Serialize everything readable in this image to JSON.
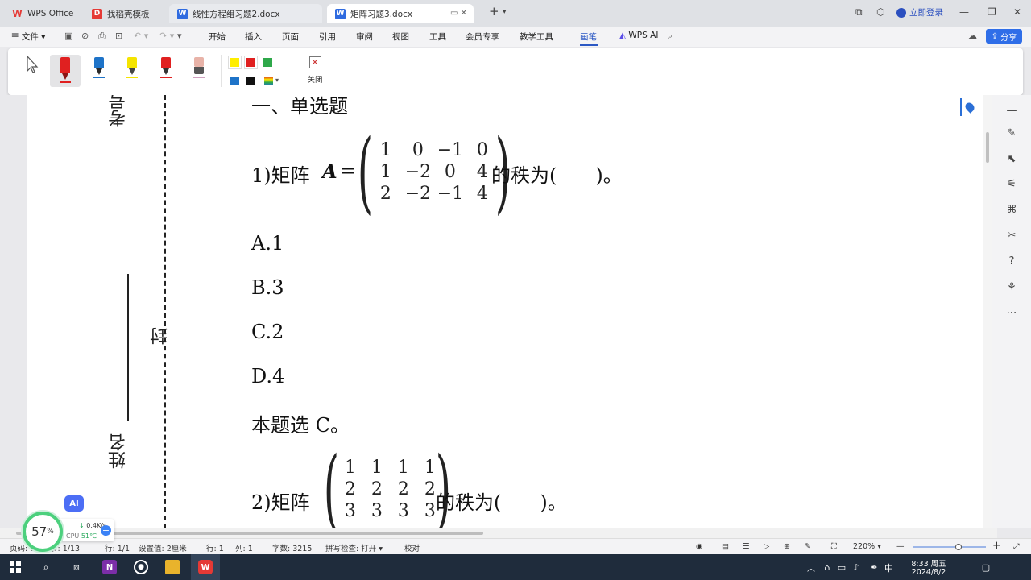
{
  "tabs": [
    {
      "label": "WPS Office",
      "icon": "wps-logo-icon",
      "color": "#e53935"
    },
    {
      "label": "找稻壳模板",
      "icon": "docer-icon",
      "color": "#e53935"
    },
    {
      "label": "线性方程组习题2.docx",
      "icon": "word-doc-icon",
      "color": "#2f6be0"
    },
    {
      "label": "矩阵习题3.docx",
      "icon": "word-doc-icon",
      "color": "#2f6be0",
      "active": true
    }
  ],
  "titlebar": {
    "login_label": "立即登录"
  },
  "menu": {
    "file_label": "文件",
    "items": [
      "开始",
      "插入",
      "页面",
      "引用",
      "审阅",
      "视图",
      "工具",
      "会员专享",
      "教学工具",
      "画笔",
      "WPS AI"
    ],
    "active": "画笔",
    "share_label": "分享"
  },
  "pen_toolbar": {
    "pens": [
      {
        "name": "red-marker",
        "color": "#e02020"
      },
      {
        "name": "blue-pen",
        "color": "#1e73c8"
      },
      {
        "name": "yellow-highlighter",
        "color": "#f5e400"
      },
      {
        "name": "red-pen",
        "color": "#e02020"
      },
      {
        "name": "eraser",
        "color": "#e8b3a8"
      }
    ],
    "swatches_row1": [
      "#ffee00",
      "#e02020",
      "#2ea84a"
    ],
    "swatches_row2": [
      "#1e73c8",
      "#111111"
    ],
    "close_label": "关闭"
  },
  "document": {
    "margin_labels": {
      "exam_no": "考号",
      "seal": "封",
      "name": "姓名"
    },
    "section_title": "一、单选题",
    "q1": {
      "prefix": "1)矩阵",
      "matrix_label": "A",
      "equals": "=",
      "suffix": "的秩为(　　)。",
      "matrix": [
        [
          "1",
          "0",
          "−1",
          "0"
        ],
        [
          "1",
          "−2",
          "0",
          "4"
        ],
        [
          "2",
          "−2",
          "−1",
          "4"
        ]
      ],
      "options": [
        "A.1",
        "B.3",
        "C.2",
        "D.4"
      ],
      "answer": "本题选 C。"
    },
    "q2": {
      "prefix": "2)矩阵",
      "suffix": "的秩为(　　)。",
      "matrix": [
        [
          "1",
          "1",
          "1",
          "1"
        ],
        [
          "2",
          "2",
          "2",
          "2"
        ],
        [
          "3",
          "3",
          "3",
          "3"
        ]
      ]
    }
  },
  "statusbar": {
    "page": "页码: 1",
    "section": "节: 1/13",
    "column": "行: 1/1",
    "settings": "设置值: 2厘米",
    "row": "行: 1",
    "col": "列: 1",
    "word_count": "字数: 3215",
    "spellcheck": "拼写检查: 打开",
    "proofread": "校对",
    "zoom": "220%"
  },
  "widgets": {
    "ai_label": "AI",
    "perf_percent": "57",
    "perf_unit": "%",
    "net_speed": "0.4K/s",
    "cpu_label": "CPU",
    "cpu_temp": "51℃"
  },
  "taskbar": {
    "ime": "中",
    "time": "8:33 周五",
    "date": "2024/8/2"
  }
}
